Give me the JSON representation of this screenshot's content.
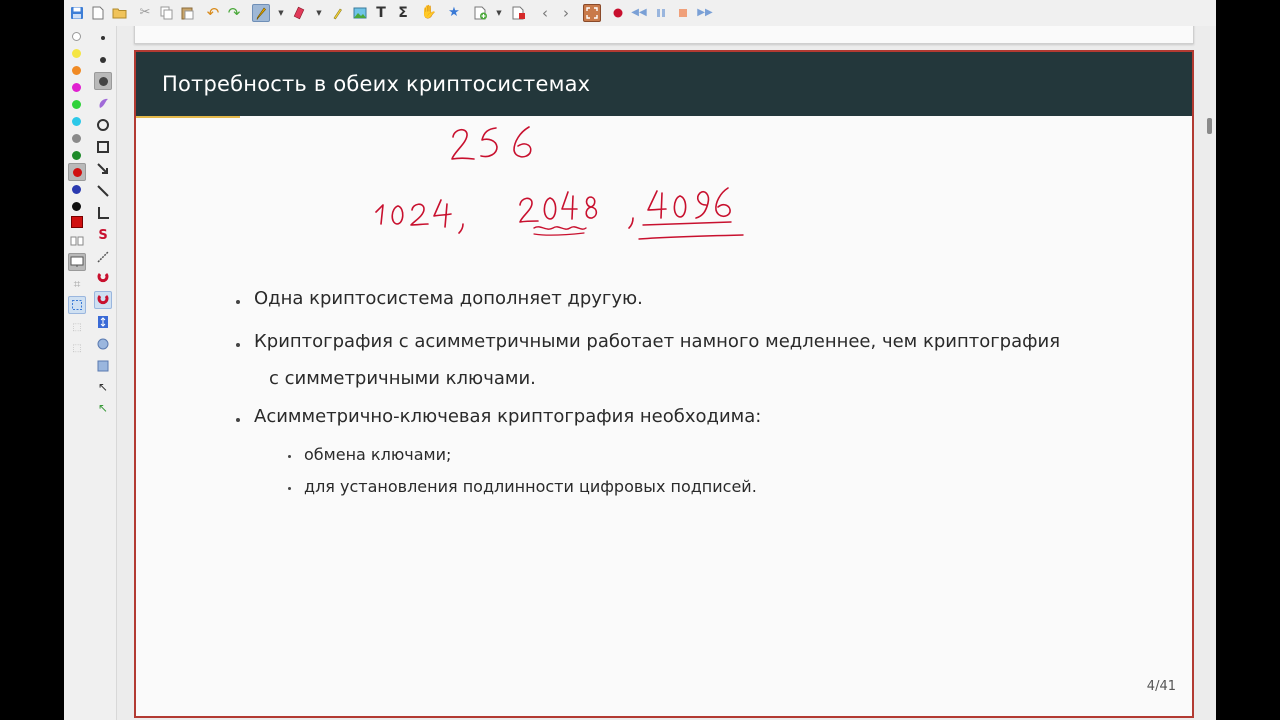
{
  "slide": {
    "title": "Потребность в обеих криптосистемах",
    "bullets": [
      "Одна криптосистема дополняет другую.",
      "Криптография с асимметричными работает намного медленнее, чем криптография",
      "с симметричными ключами.",
      "Асимметрично-ключевая криптография необходима:"
    ],
    "subbullets": [
      "обмена ключами;",
      "для установления подлинности цифровых подписей."
    ],
    "page_number": "4/41"
  },
  "handwriting": {
    "line1": "256",
    "line2": [
      "1024,",
      "2048",
      ",4096"
    ],
    "color": "#c8102e"
  },
  "palette_colors": [
    "#ffffff",
    "#f4e542",
    "#f08a24",
    "#e020d0",
    "#2fd23a",
    "#2cc8e8",
    "#8a8a8a",
    "#1e8a2a",
    "#d01010",
    "#2a3ab0",
    "#101010",
    "#d01010"
  ],
  "colors": {
    "frame_title_bg": "#23373b",
    "slide_border": "#b23a32",
    "progress": "#e4b84a"
  }
}
